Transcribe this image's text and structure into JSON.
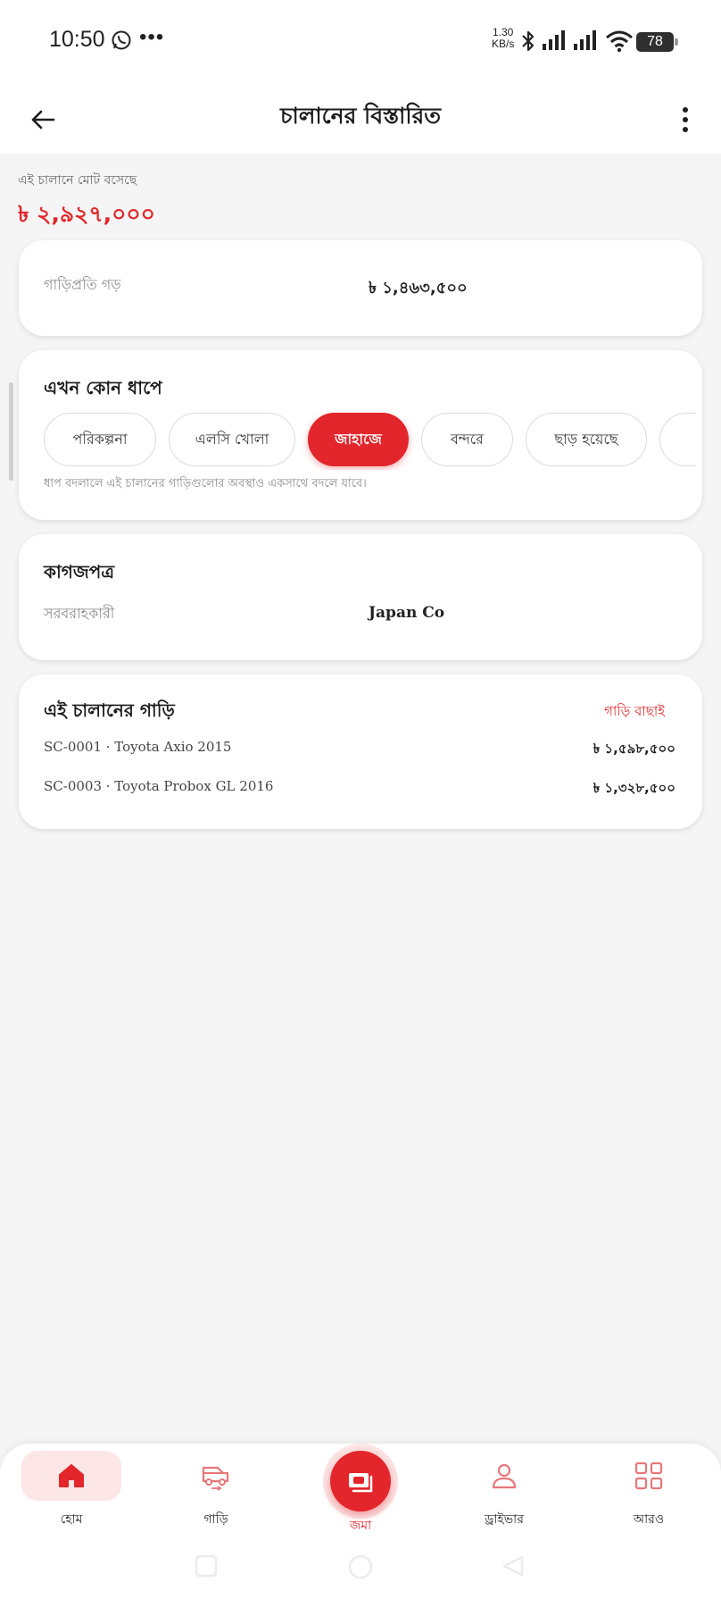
{
  "status_bar": {
    "time": "10:50",
    "more": "•••",
    "net_speed_value": "1.30",
    "net_speed_unit": "KB/s",
    "battery": "78"
  },
  "app_bar": {
    "title": "চালানের বিস্তারিত"
  },
  "summary": {
    "total_label": "এই চালানে মোট বসেছে",
    "total_value": "৳ ২,৯২৭,০০০"
  },
  "average": {
    "label": "গাড়িপ্রতি গড়",
    "value": "৳ ১,৪৬৩,৫০০"
  },
  "stage": {
    "title": "এখন কোন ধাপে",
    "chips": [
      "পরিকল্পনা",
      "এলসি খোলা",
      "জাহাজে",
      "বন্দরে",
      "ছাড় হয়েছে",
      ""
    ],
    "active_index": 2,
    "hint": "ধাপ বদলালে এই চালানের গাড়িগুলোর অবস্থাও একসাথে বদলে যাবে।"
  },
  "documents": {
    "title": "কাগজপত্র",
    "supplier_label": "সরবরাহকারী",
    "supplier_value": "Japan Co"
  },
  "cars": {
    "title": "এই চালানের গাড়ি",
    "select_link": "গাড়ি বাছাই",
    "items": [
      {
        "name": "SC-0001 · Toyota Axio 2015",
        "price": "৳ ১,৫৯৮,৫০০"
      },
      {
        "name": "SC-0003 · Toyota Probox GL 2016",
        "price": "৳ ১,৩২৮,৫০০"
      }
    ]
  },
  "bottom_nav": {
    "home": "হোম",
    "cars": "গাড়ি",
    "deposit": "জমা",
    "driver": "ড্রাইভার",
    "more": "আরও"
  },
  "colors": {
    "accent": "#e2262b",
    "background": "#f4f5f4",
    "card": "#ffffff",
    "home_pill": "#fde6e6"
  }
}
